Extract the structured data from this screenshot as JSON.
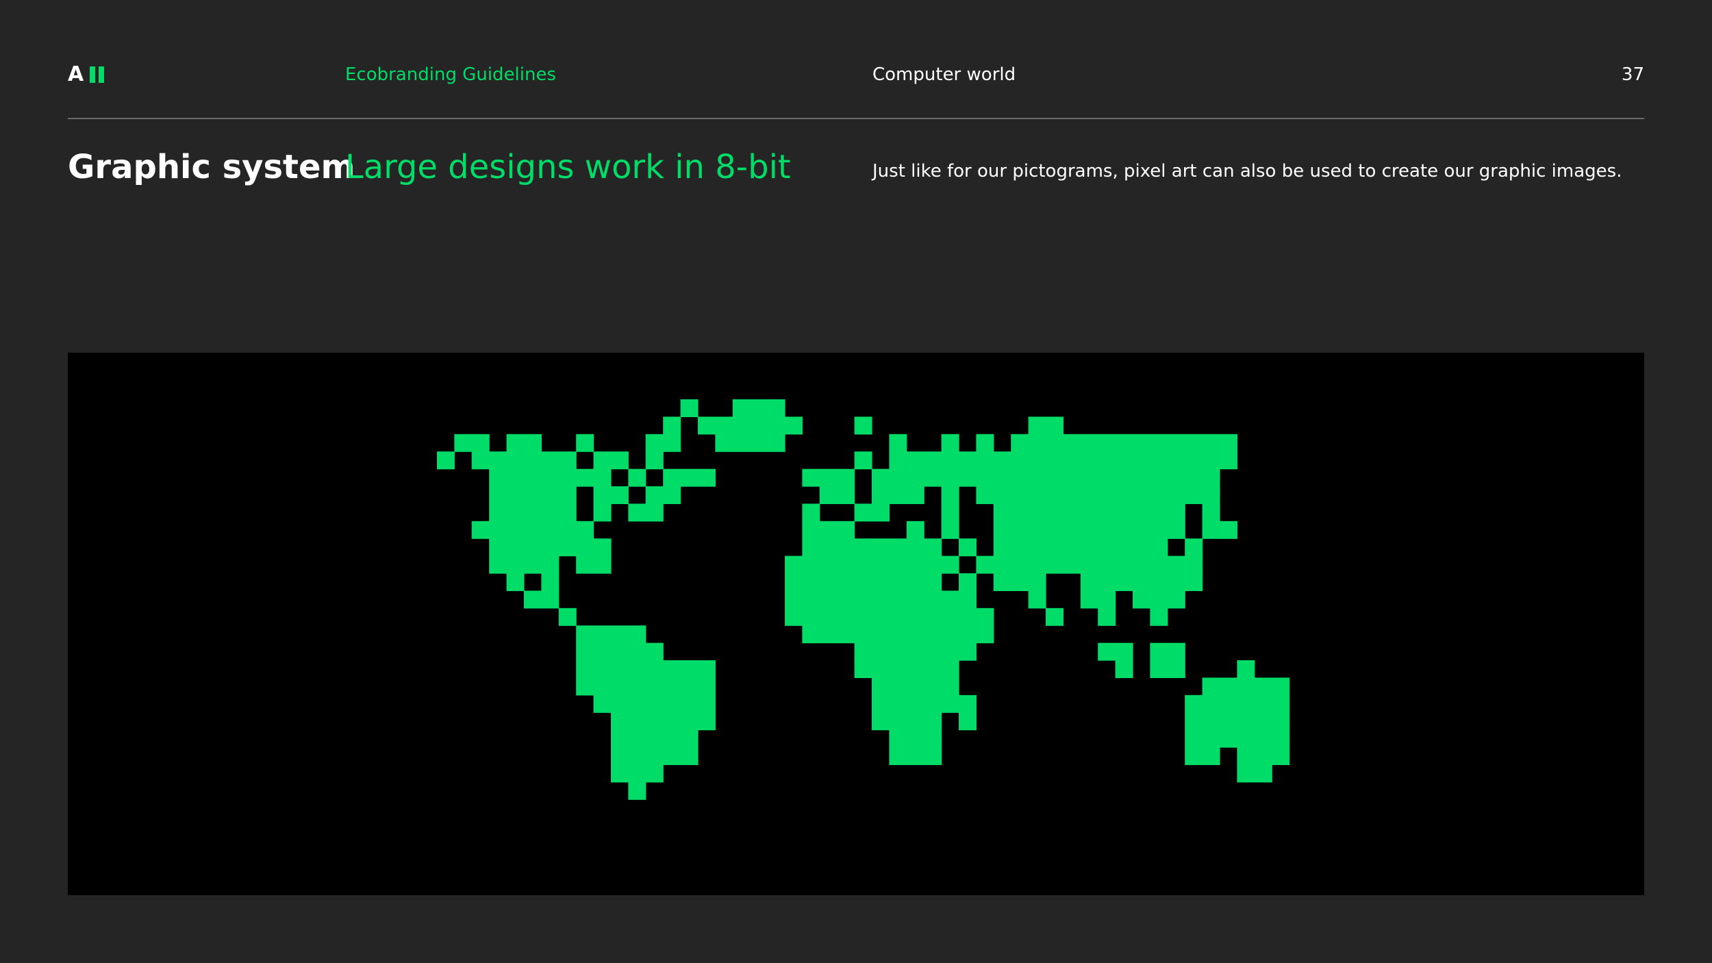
{
  "logo": {
    "letter": "A",
    "bars_color": "#00dc68"
  },
  "header": {
    "section": "Ecobranding Guidelines",
    "chapter": "Computer world",
    "page_number": "37"
  },
  "content": {
    "title": "Graphic system",
    "subtitle": "Large designs work in 8-bit",
    "description": "Just like for our pictograms, pixel art can also be used to create our graphic images."
  },
  "illustration": {
    "icon": "pixel-world-map-icon",
    "pixel_color": "#00dc68",
    "background_color": "#000000"
  }
}
